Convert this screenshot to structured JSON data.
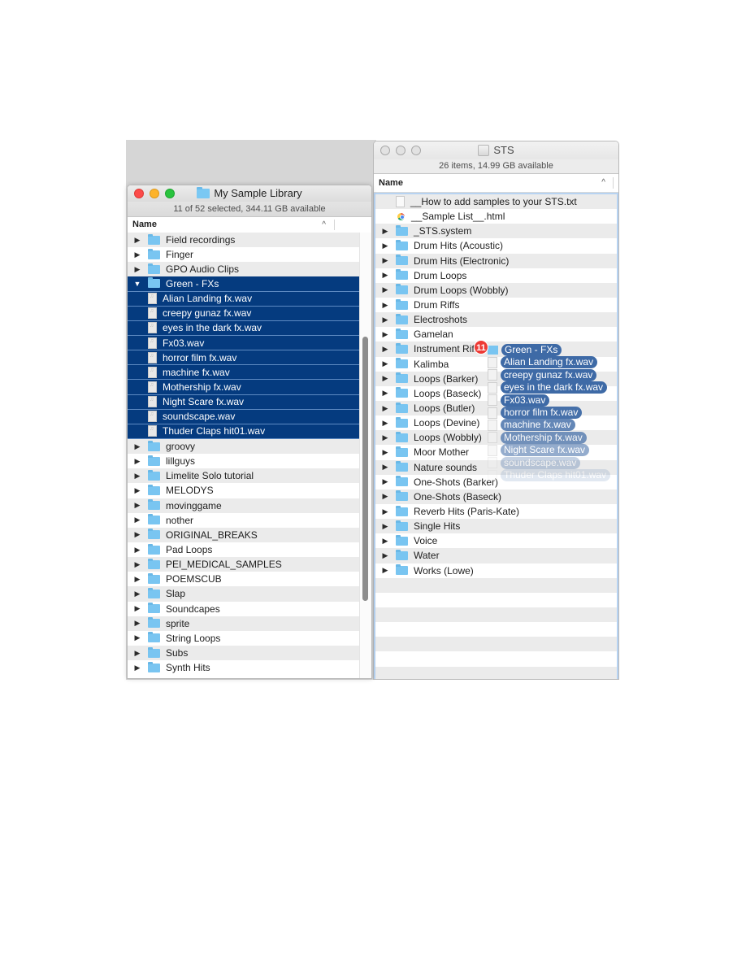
{
  "left_window": {
    "title": "My Sample Library",
    "status": "11 of 52 selected, 344.11 GB available",
    "column_header": "Name",
    "sort_indicator": "^",
    "scroll_position_fraction": 0.3,
    "rows": [
      {
        "kind": "folder",
        "label": "Field recordings",
        "disclosure": "▶",
        "selected": false
      },
      {
        "kind": "folder",
        "label": "Finger",
        "disclosure": "▶",
        "selected": false
      },
      {
        "kind": "folder",
        "label": "GPO Audio Clips",
        "disclosure": "▶",
        "selected": false
      },
      {
        "kind": "folder",
        "label": "Green - FXs",
        "disclosure": "▼",
        "selected": true
      },
      {
        "kind": "audio",
        "label": "Alian Landing fx.wav",
        "selected": true
      },
      {
        "kind": "audio",
        "label": "creepy gunaz fx.wav",
        "selected": true
      },
      {
        "kind": "audio",
        "label": "eyes in the dark fx.wav",
        "selected": true
      },
      {
        "kind": "audio",
        "label": "Fx03.wav",
        "selected": true
      },
      {
        "kind": "audio",
        "label": "horror film fx.wav",
        "selected": true
      },
      {
        "kind": "audio",
        "label": "machine fx.wav",
        "selected": true
      },
      {
        "kind": "audio",
        "label": "Mothership fx.wav",
        "selected": true
      },
      {
        "kind": "audio",
        "label": "Night Scare fx.wav",
        "selected": true
      },
      {
        "kind": "audio",
        "label": "soundscape.wav",
        "selected": true
      },
      {
        "kind": "audio",
        "label": "Thuder Claps hit01.wav",
        "selected": true
      },
      {
        "kind": "folder",
        "label": "groovy",
        "disclosure": "▶",
        "selected": false
      },
      {
        "kind": "folder",
        "label": "lillguys",
        "disclosure": "▶",
        "selected": false
      },
      {
        "kind": "folder",
        "label": "Limelite Solo tutorial",
        "disclosure": "▶",
        "selected": false
      },
      {
        "kind": "folder",
        "label": "MELODYS",
        "disclosure": "▶",
        "selected": false
      },
      {
        "kind": "folder",
        "label": "movinggame",
        "disclosure": "▶",
        "selected": false
      },
      {
        "kind": "folder",
        "label": "nother",
        "disclosure": "▶",
        "selected": false
      },
      {
        "kind": "folder",
        "label": "ORIGINAL_BREAKS",
        "disclosure": "▶",
        "selected": false
      },
      {
        "kind": "folder",
        "label": "Pad Loops",
        "disclosure": "▶",
        "selected": false
      },
      {
        "kind": "folder",
        "label": "PEI_MEDICAL_SAMPLES",
        "disclosure": "▶",
        "selected": false
      },
      {
        "kind": "folder",
        "label": "POEMSCUB",
        "disclosure": "▶",
        "selected": false
      },
      {
        "kind": "folder",
        "label": "Slap",
        "disclosure": "▶",
        "selected": false
      },
      {
        "kind": "folder",
        "label": "Soundcapes",
        "disclosure": "▶",
        "selected": false
      },
      {
        "kind": "folder",
        "label": "sprite",
        "disclosure": "▶",
        "selected": false
      },
      {
        "kind": "folder",
        "label": "String Loops",
        "disclosure": "▶",
        "selected": false
      },
      {
        "kind": "folder",
        "label": "Subs",
        "disclosure": "▶",
        "selected": false
      },
      {
        "kind": "folder",
        "label": "Synth Hits",
        "disclosure": "▶",
        "selected": false
      }
    ]
  },
  "right_window": {
    "title": "STS",
    "status": "26 items, 14.99 GB available",
    "column_header": "Name",
    "sort_indicator": "^",
    "rows": [
      {
        "kind": "text",
        "label": "__How to add samples to your STS.txt"
      },
      {
        "kind": "html",
        "label": "__Sample List__.html"
      },
      {
        "kind": "folder",
        "label": "_STS.system",
        "disclosure": "▶"
      },
      {
        "kind": "folder",
        "label": "Drum Hits (Acoustic)",
        "disclosure": "▶"
      },
      {
        "kind": "folder",
        "label": "Drum Hits (Electronic)",
        "disclosure": "▶"
      },
      {
        "kind": "folder",
        "label": "Drum Loops",
        "disclosure": "▶"
      },
      {
        "kind": "folder",
        "label": "Drum Loops (Wobbly)",
        "disclosure": "▶"
      },
      {
        "kind": "folder",
        "label": "Drum Riffs",
        "disclosure": "▶"
      },
      {
        "kind": "folder",
        "label": "Electroshots",
        "disclosure": "▶"
      },
      {
        "kind": "folder",
        "label": "Gamelan",
        "disclosure": "▶"
      },
      {
        "kind": "folder",
        "label": "Instrument Riffs",
        "disclosure": "▶"
      },
      {
        "kind": "folder",
        "label": "Kalimba",
        "disclosure": "▶"
      },
      {
        "kind": "folder",
        "label": "Loops (Barker)",
        "disclosure": "▶"
      },
      {
        "kind": "folder",
        "label": "Loops (Baseck)",
        "disclosure": "▶"
      },
      {
        "kind": "folder",
        "label": "Loops (Butler)",
        "disclosure": "▶"
      },
      {
        "kind": "folder",
        "label": "Loops (Devine)",
        "disclosure": "▶"
      },
      {
        "kind": "folder",
        "label": "Loops (Wobbly)",
        "disclosure": "▶"
      },
      {
        "kind": "folder",
        "label": "Moor Mother",
        "disclosure": "▶"
      },
      {
        "kind": "folder",
        "label": "Nature sounds",
        "disclosure": "▶"
      },
      {
        "kind": "folder",
        "label": "One-Shots (Barker)",
        "disclosure": "▶"
      },
      {
        "kind": "folder",
        "label": "One-Shots (Baseck)",
        "disclosure": "▶"
      },
      {
        "kind": "folder",
        "label": "Reverb Hits (Paris-Kate)",
        "disclosure": "▶"
      },
      {
        "kind": "folder",
        "label": "Single Hits",
        "disclosure": "▶"
      },
      {
        "kind": "folder",
        "label": "Voice",
        "disclosure": "▶"
      },
      {
        "kind": "folder",
        "label": "Water",
        "disclosure": "▶"
      },
      {
        "kind": "folder",
        "label": "Works (Lowe)",
        "disclosure": "▶"
      }
    ],
    "empty_rows": 7
  },
  "drag": {
    "count_badge": "11",
    "items": [
      {
        "kind": "folder",
        "label": "Green - FXs",
        "opacity": 1
      },
      {
        "kind": "audio",
        "label": "Alian Landing fx.wav",
        "opacity": 1
      },
      {
        "kind": "audio",
        "label": "creepy gunaz fx.wav",
        "opacity": 1
      },
      {
        "kind": "audio",
        "label": "eyes in the dark fx.wav",
        "opacity": 1
      },
      {
        "kind": "audio",
        "label": "Fx03.wav",
        "opacity": 1
      },
      {
        "kind": "audio",
        "label": "horror film fx.wav",
        "opacity": 0.95
      },
      {
        "kind": "audio",
        "label": "machine fx.wav",
        "opacity": 0.8
      },
      {
        "kind": "audio",
        "label": "Mothership fx.wav",
        "opacity": 0.7
      },
      {
        "kind": "audio",
        "label": "Night Scare fx.wav",
        "opacity": 0.55
      },
      {
        "kind": "audio",
        "label": "soundscape.wav",
        "opacity": 0.3
      },
      {
        "kind": "audio",
        "label": "Thuder Claps hit01.wav",
        "opacity": 0.15
      }
    ]
  },
  "colors": {
    "selection": "#053b7f",
    "drag_label": "#3e6aa6",
    "badge": "#ed3a35",
    "folder": "#79c5f1"
  }
}
